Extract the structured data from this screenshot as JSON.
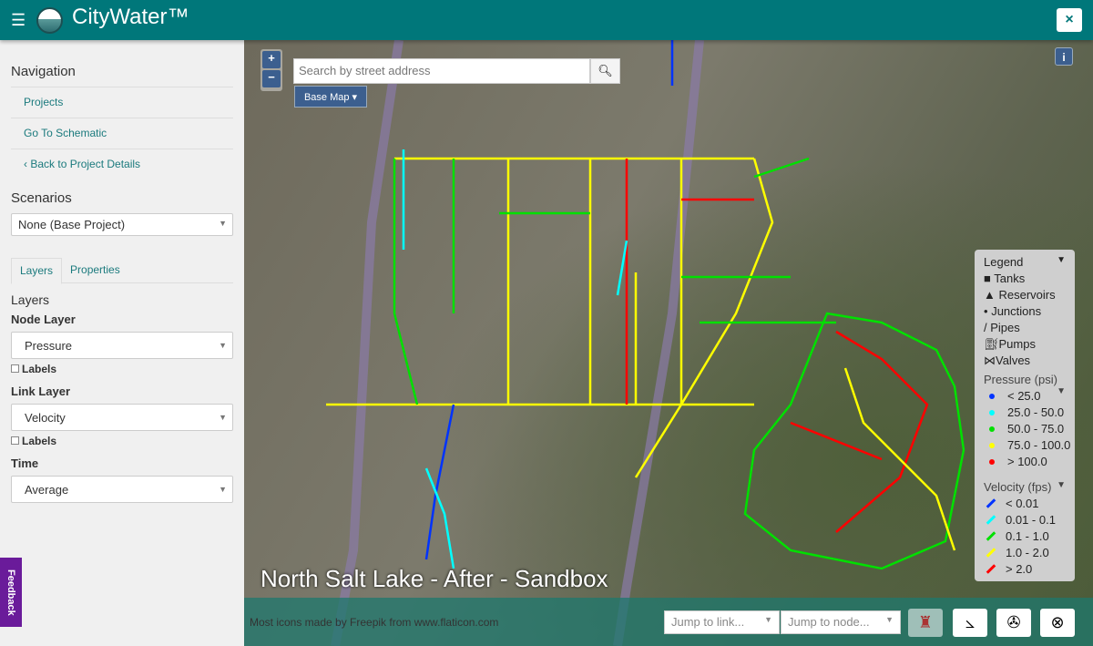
{
  "header": {
    "title": "CityWater™",
    "menu_icon": "hamburger-icon",
    "close_label": "×"
  },
  "sidebar": {
    "navigation_heading": "Navigation",
    "nav_items": [
      {
        "label": "Projects"
      },
      {
        "label": "Go To Schematic"
      },
      {
        "label": "Back to Project Details"
      }
    ],
    "scenarios_heading": "Scenarios",
    "scenario_value": "None (Base Project)",
    "tabs": [
      {
        "label": "Layers",
        "active": true
      },
      {
        "label": "Properties",
        "active": false
      }
    ],
    "layers_heading": "Layers",
    "node_layer_label": "Node Layer",
    "node_layer_value": "Pressure",
    "node_labels": "Labels",
    "link_layer_label": "Link Layer",
    "link_layer_value": "Velocity",
    "link_labels": "Labels",
    "time_label": "Time",
    "time_value": "Average"
  },
  "feedback": "Feedback",
  "map": {
    "zoom_in": "+",
    "zoom_out": "−",
    "search_placeholder": "Search by street address",
    "base_map_label": "Base Map ▾",
    "info_label": "i",
    "scenario_title": "North Salt Lake - After - Sandbox",
    "credit": "Most icons made by Freepik from www.flaticon.com",
    "jump_link_placeholder": "Jump to link...",
    "jump_node_placeholder": "Jump to node..."
  },
  "legend": {
    "title": "Legend",
    "symbols": [
      {
        "label": "Tanks"
      },
      {
        "label": "Reservoirs"
      },
      {
        "label": "Junctions"
      },
      {
        "label": "Pipes"
      },
      {
        "label": "Pumps"
      },
      {
        "label": "Valves"
      }
    ],
    "pressure_title": "Pressure (psi)",
    "pressure": [
      {
        "label": "< 25.0",
        "color": "#0033ff"
      },
      {
        "label": "25.0 - 50.0",
        "color": "#00ffff"
      },
      {
        "label": "50.0 - 75.0",
        "color": "#00e000"
      },
      {
        "label": "75.0 - 100.0",
        "color": "#ffff00"
      },
      {
        "label": "> 100.0",
        "color": "#ff0000"
      }
    ],
    "velocity_title": "Velocity (fps)",
    "velocity": [
      {
        "label": "< 0.01",
        "color": "#0033ff"
      },
      {
        "label": "0.01 - 0.1",
        "color": "#00ffff"
      },
      {
        "label": "0.1 - 1.0",
        "color": "#00e000"
      },
      {
        "label": "1.0 - 2.0",
        "color": "#ffff00"
      },
      {
        "label": "> 2.0",
        "color": "#ff0000"
      }
    ]
  }
}
